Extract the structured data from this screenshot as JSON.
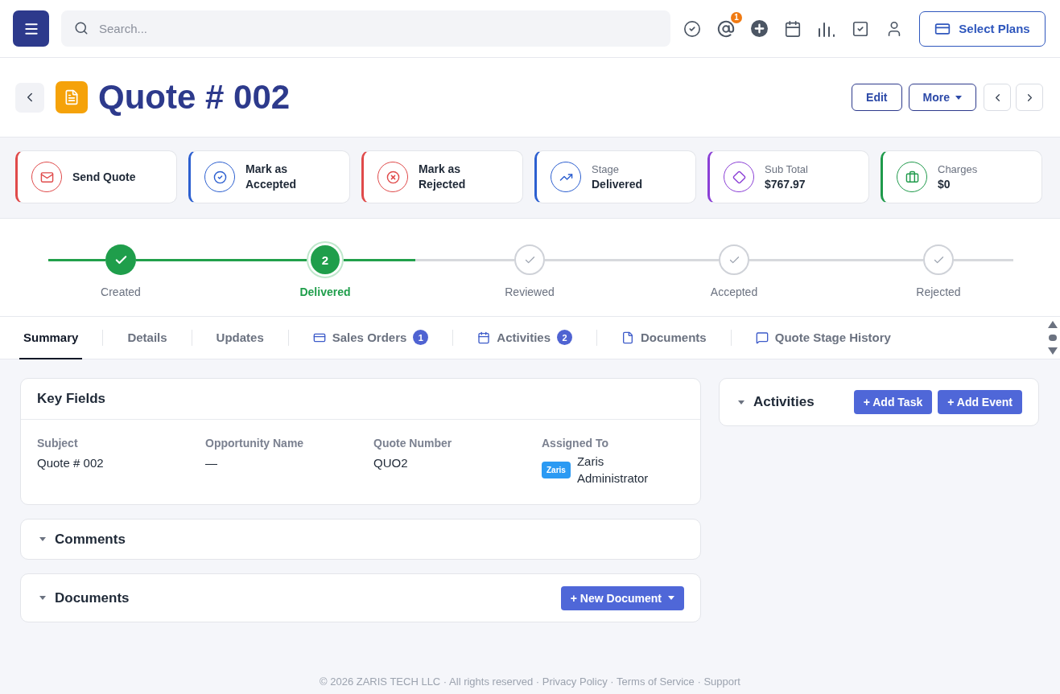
{
  "topbar": {
    "search": {
      "placeholder": "Search..."
    },
    "mentions_badge": "1",
    "plans_button": "Select Plans"
  },
  "header": {
    "title": "Quote # 002",
    "buttons": [
      {
        "label": "Edit",
        "kind": "plain"
      },
      {
        "label": "More",
        "kind": "dropdown"
      }
    ]
  },
  "action_cards": [
    {
      "kind": "action",
      "label": "Send Quote",
      "color": "#e04a4a"
    },
    {
      "kind": "action",
      "label": "Mark as Accepted",
      "color": "#2c5fd0"
    },
    {
      "kind": "action",
      "label": "Mark as Rejected",
      "color": "#e04a4a"
    },
    {
      "kind": "stat",
      "label": "Stage",
      "value": "Delivered",
      "color": "#2c5fd0"
    },
    {
      "kind": "stat",
      "label": "Sub Total",
      "value": "$767.97",
      "color": "#8b3fd6"
    },
    {
      "kind": "stat",
      "label": "Charges",
      "value": "$0",
      "color": "#1f9a4b"
    }
  ],
  "stepper": [
    {
      "label": "Created",
      "completed": true,
      "selected": false
    },
    {
      "label": "Delivered",
      "completed": false,
      "selected": true,
      "number": "2"
    },
    {
      "label": "Reviewed",
      "completed": false,
      "selected": false
    },
    {
      "label": "Accepted",
      "completed": false,
      "selected": false
    },
    {
      "label": "Rejected",
      "completed": false,
      "selected": false
    }
  ],
  "tabs": [
    {
      "label": "Summary",
      "selected": true
    },
    {
      "label": "Details",
      "selected": false
    },
    {
      "label": "Updates",
      "selected": false
    },
    {
      "label": "Sales Orders",
      "selected": false,
      "count": "1"
    },
    {
      "label": "Activities",
      "selected": false,
      "count": "2"
    },
    {
      "label": "Documents",
      "selected": false
    },
    {
      "label": "Quote Stage History",
      "selected": false
    }
  ],
  "key_fields": {
    "title": "Key Fields",
    "fields": [
      {
        "kind": "text",
        "label": "Subject",
        "value": "Quote # 002"
      },
      {
        "kind": "text",
        "label": "Opportunity Name",
        "value": "—"
      },
      {
        "kind": "text",
        "label": "Quote Number",
        "value": "QUO2"
      },
      {
        "kind": "user",
        "label": "Assigned To",
        "tag": "Zaris",
        "value": "Zaris Administrator"
      }
    ]
  },
  "comments": {
    "title": "Comments"
  },
  "documents": {
    "title": "Documents",
    "button": "+ New Document"
  },
  "activities": {
    "title": "Activities",
    "buttons": [
      "+ Add Task",
      "+ Add Event"
    ]
  },
  "footer": {
    "notice": "© 2026 ZARIS TECH LLC · All rights reserved",
    "separator": "·",
    "links": [
      "Privacy Policy",
      "Terms of Service",
      "Support"
    ]
  }
}
